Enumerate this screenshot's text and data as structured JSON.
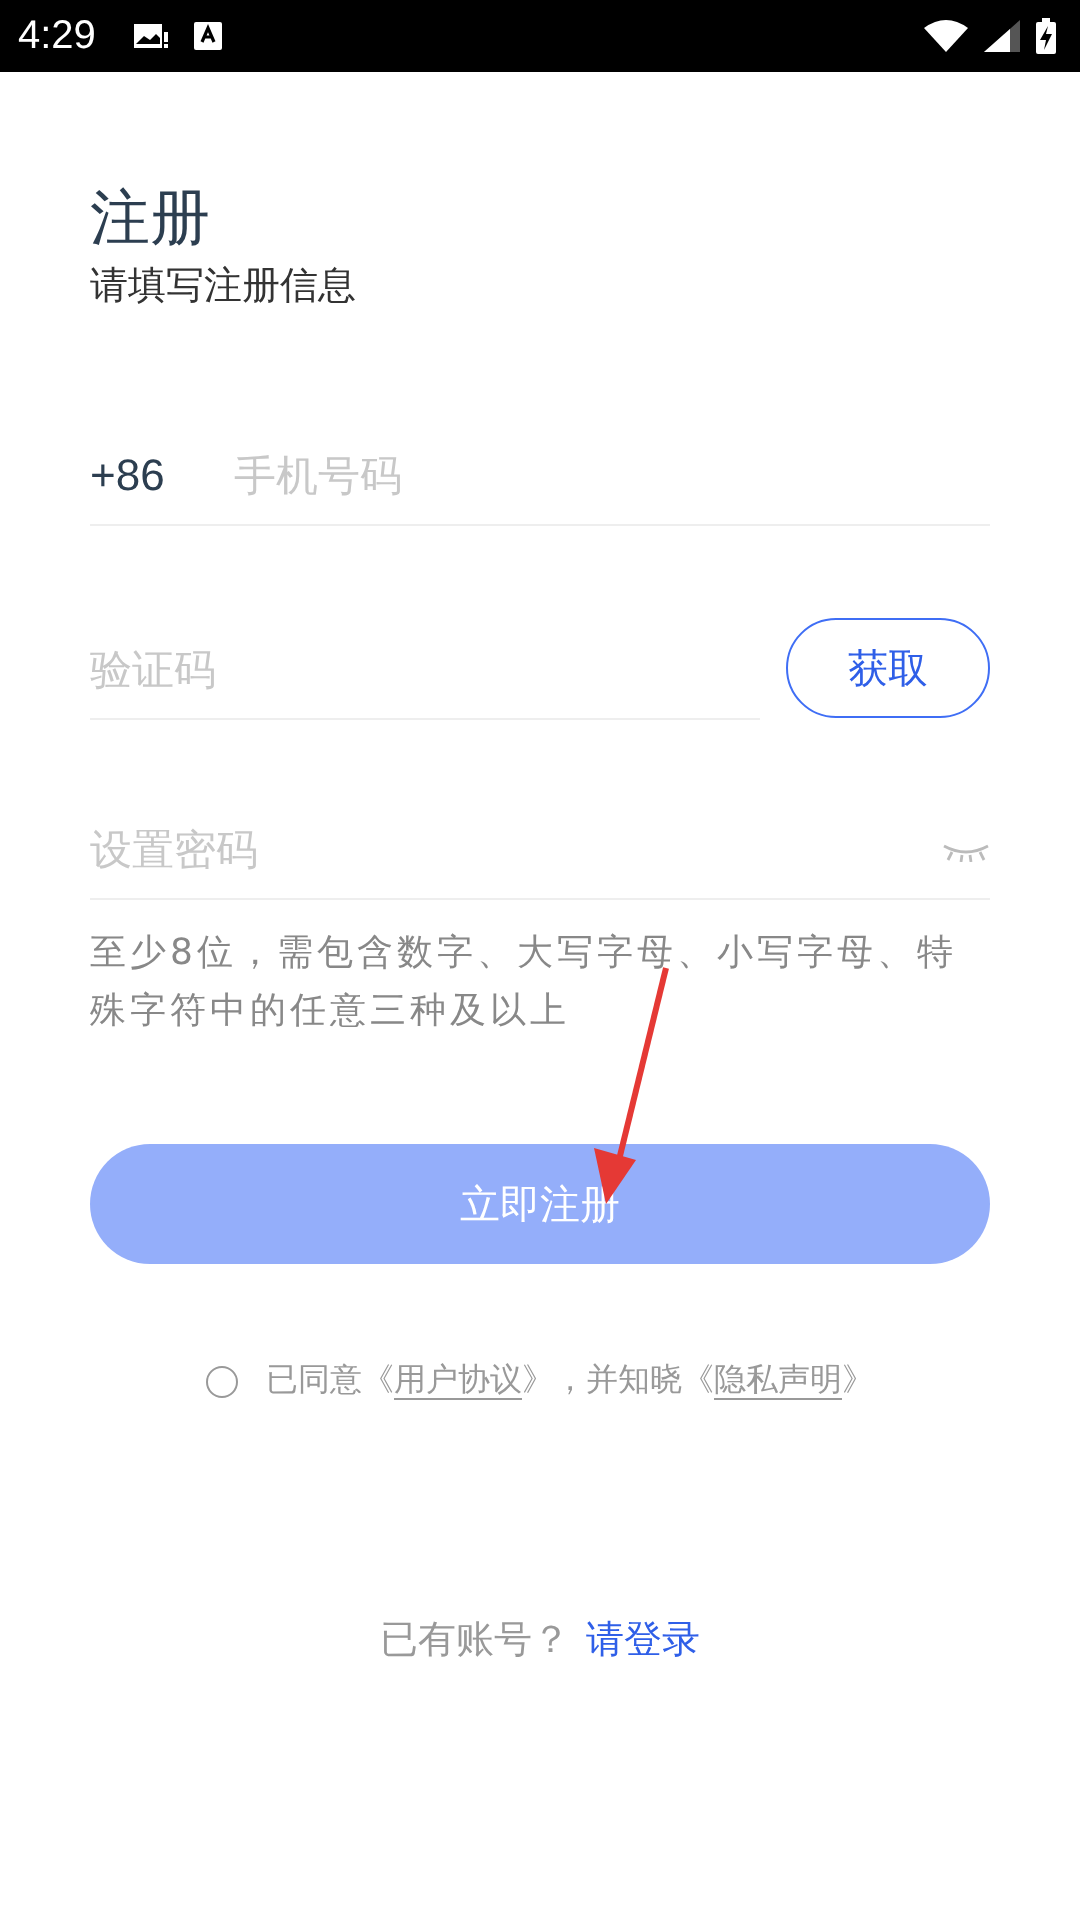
{
  "status_bar": {
    "time": "4:29"
  },
  "header": {
    "title": "注册",
    "subtitle": "请填写注册信息"
  },
  "phone": {
    "prefix": "+86",
    "placeholder": "手机号码"
  },
  "code": {
    "placeholder": "验证码",
    "button": "获取"
  },
  "password": {
    "placeholder": "设置密码",
    "visible": false
  },
  "hint": "至少8位，需包含数字、大写字母、小写字母、特殊字符中的任意三种及以上",
  "submit": {
    "label": "立即注册",
    "disabled": true
  },
  "agreement": {
    "checked": false,
    "parts": [
      {
        "kind": "text",
        "text": "已同意《"
      },
      {
        "kind": "link",
        "text": "用户协议"
      },
      {
        "kind": "text",
        "text": "》，并知晓《"
      },
      {
        "kind": "link",
        "text": "隐私声明"
      },
      {
        "kind": "text",
        "text": "》"
      }
    ]
  },
  "login": {
    "prompt": "已有账号？",
    "link": "请登录"
  },
  "annotations": [
    {
      "kind": "arrow"
    }
  ]
}
